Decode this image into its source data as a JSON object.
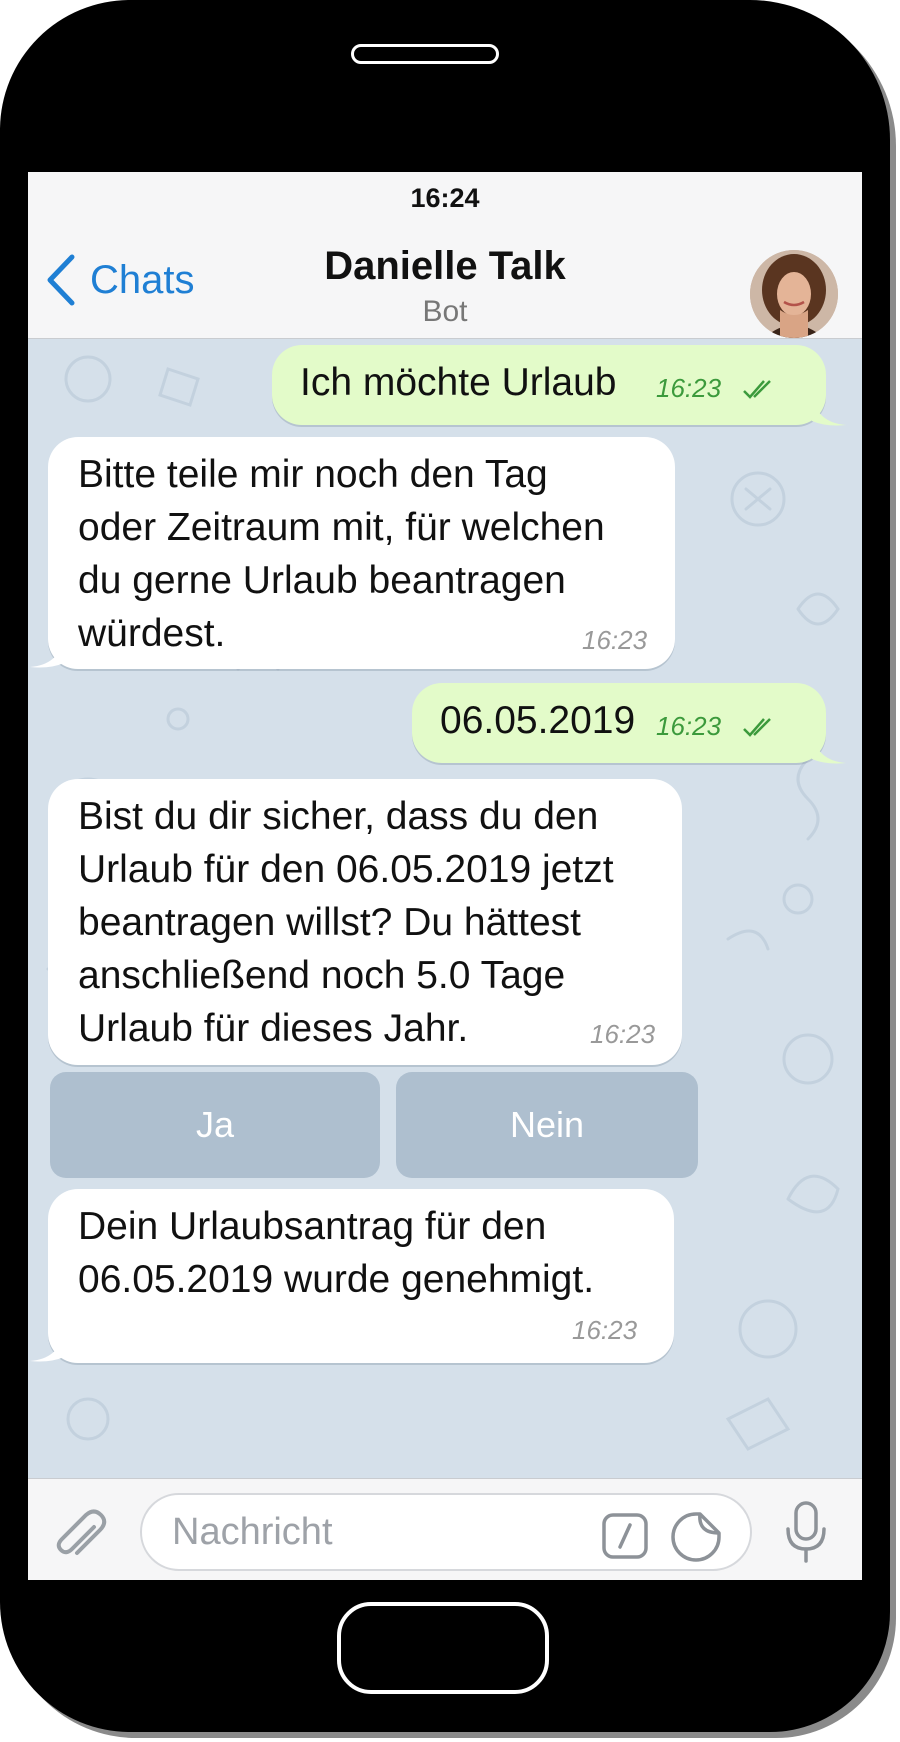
{
  "status_bar": {
    "time": "16:24"
  },
  "header": {
    "back_label": "Chats",
    "title": "Danielle Talk",
    "subtitle": "Bot"
  },
  "messages": [
    {
      "direction": "outgoing",
      "text": "Ich möchte Urlaub",
      "time": "16:23",
      "read": true
    },
    {
      "direction": "incoming",
      "lines": [
        "Bitte teile mir noch den Tag",
        "oder Zeitraum mit, für welchen",
        "du gerne Urlaub beantragen",
        "würdest."
      ],
      "time": "16:23"
    },
    {
      "direction": "outgoing",
      "text": "06.05.2019",
      "time": "16:23",
      "read": true
    },
    {
      "direction": "incoming",
      "lines": [
        "Bist du dir sicher, dass du den",
        "Urlaub für den 06.05.2019 jetzt",
        "beantragen willst? Du hättest",
        "anschließend noch 5.0 Tage",
        "Urlaub für dieses Jahr."
      ],
      "time": "16:23"
    },
    {
      "direction": "incoming",
      "lines": [
        "Dein Urlaubsantrag für den",
        "06.05.2019 wurde genehmigt."
      ],
      "time": "16:23"
    }
  ],
  "inline_keyboard": [
    {
      "label": "Ja"
    },
    {
      "label": "Nein"
    }
  ],
  "composer": {
    "placeholder": "Nachricht"
  },
  "icons": {
    "back": "chevron-left-icon",
    "attach": "paperclip-icon",
    "command": "slash-command-icon",
    "sticker": "sticker-icon",
    "mic": "microphone-icon",
    "read": "double-check-icon"
  },
  "colors": {
    "accent": "#1f7fd4",
    "outgoing_bubble": "#e3fbc9",
    "incoming_bubble": "#ffffff",
    "keyboard_button": "#aebfcf",
    "read_checks": "#3c9a3c",
    "chat_background": "#d5e0ea"
  }
}
